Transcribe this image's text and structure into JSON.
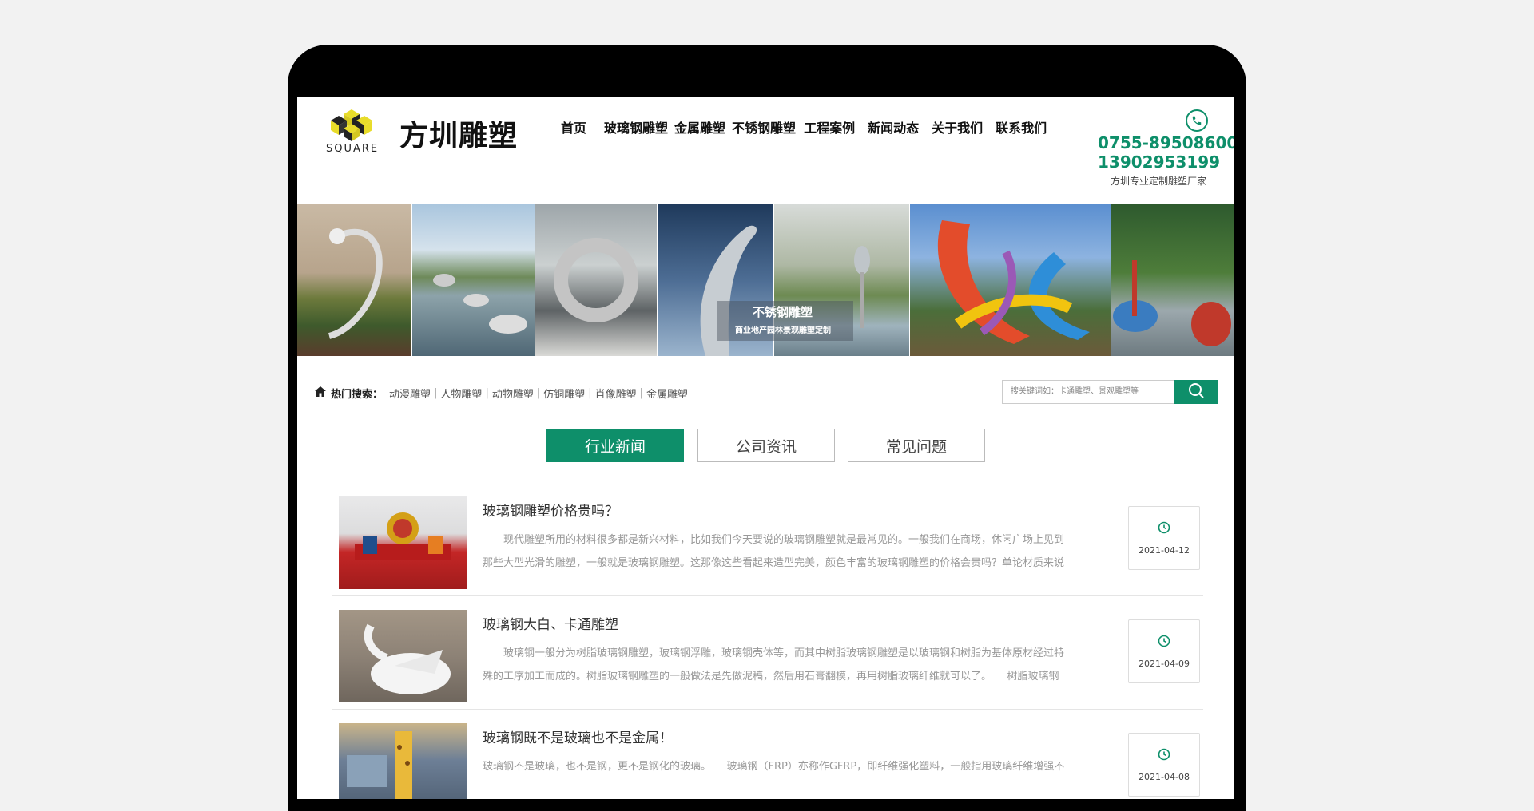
{
  "header": {
    "brand": "方圳雕塑",
    "logo_text": "SQUARE",
    "nav": [
      "首页",
      "玻璃钢雕塑",
      "金属雕塑",
      "不锈钢雕塑",
      "工程案例",
      "新闻动态",
      "关于我们",
      "联系我们"
    ],
    "phone_1": "0755-89508600",
    "phone_2": "13902953199",
    "slogan": "方圳专业定制雕塑厂家",
    "phone_icon": "phone-icon"
  },
  "banner": {
    "title": "不锈钢雕塑",
    "subtitle": "商业地产园林景观雕塑定制"
  },
  "hot_search": {
    "label": "热门搜索：",
    "links": [
      "动漫雕塑",
      "人物雕塑",
      "动物雕塑",
      "仿铜雕塑",
      "肖像雕塑",
      "金属雕塑"
    ]
  },
  "search": {
    "placeholder": "搜关键词如：卡通雕塑、景观雕塑等"
  },
  "tabs": [
    "行业新闻",
    "公司资讯",
    "常见问题"
  ],
  "news": [
    {
      "title": "玻璃钢雕塑价格贵吗？",
      "line1": "　　现代雕塑所用的材料很多都是新兴材料，比如我们今天要说的玻璃钢雕塑就是最常见的。一般我们在商场，休闲广场上见到",
      "line2": "那些大型光滑的雕塑，一般就是玻璃钢雕塑。这那像这些看起来造型完美，颜色丰富的玻璃钢雕塑的价格会贵吗？单论材质来说",
      "date": "2021-04-12"
    },
    {
      "title": "玻璃钢大白、卡通雕塑",
      "line1": "　　玻璃钢一般分为树脂玻璃钢雕塑，玻璃钢浮雕，玻璃钢壳体等，而其中树脂玻璃钢雕塑是以玻璃钢和树脂为基体原材经过特",
      "line2": "殊的工序加工而成的。树脂玻璃钢雕塑的一般做法是先做泥稿，然后用石膏翻模，再用树脂玻璃纤维就可以了。　　树脂玻璃钢",
      "date": "2021-04-09"
    },
    {
      "title": "玻璃钢既不是玻璃也不是金属！",
      "line1": "玻璃钢不是玻璃，也不是钢，更不是钢化的玻璃。　　玻璃钢（FRP）亦称作GFRP，即纤维强化塑料，一般指用玻璃纤维增强不",
      "line2": "",
      "date": "2021-04-08"
    }
  ]
}
